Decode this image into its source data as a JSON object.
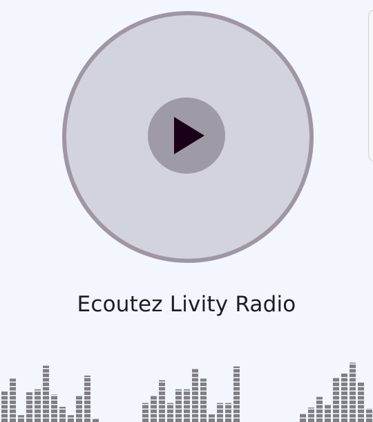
{
  "player": {
    "title": "Ecoutez Livity Radio",
    "play_icon": "play-icon",
    "accent_color": "#1a0018",
    "disc_color": "#d3d3dd",
    "ring_color": "#9e97a3"
  },
  "equalizer": {
    "icon": "equalizer-visualizer",
    "bar_color": "#7e7e84",
    "levels": [
      0.4,
      0.57,
      0.09,
      0.39,
      0.43,
      0.74,
      0.36,
      0.2,
      0.09,
      0.34,
      0.61,
      0.04,
      0,
      0,
      0,
      0,
      0,
      0.25,
      0.34,
      0.55,
      0.25,
      0.43,
      0.43,
      0.7,
      0.57,
      0.1,
      0.25,
      0.25,
      0.73,
      0,
      0,
      0,
      0,
      0,
      0,
      0,
      0.11,
      0.19,
      0.33,
      0.23,
      0.58,
      0.64,
      0.78,
      0.52,
      0.18
    ]
  }
}
